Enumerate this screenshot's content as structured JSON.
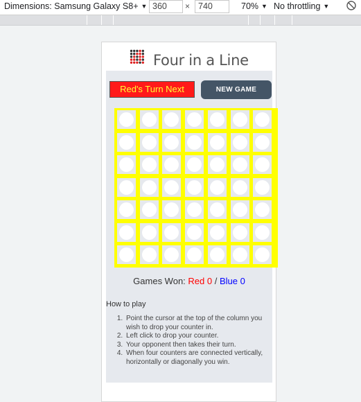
{
  "devtools": {
    "device_label": "Dimensions: Samsung Galaxy S8+",
    "width_value": "360",
    "height_value": "740",
    "times": "×",
    "zoom_label": "70%",
    "throttle_label": "No throttling",
    "dropdown_arrow": "▼",
    "rotate_icon": "⃠"
  },
  "app": {
    "title": "Four in a Line",
    "turn_label": "Red's Turn Next",
    "new_game_label": "NEW GAME",
    "board": {
      "columns": 7,
      "rows": 7
    },
    "score": {
      "prefix": "Games Won: ",
      "red_label": "Red 0",
      "separator": " / ",
      "blue_label": "Blue 0"
    },
    "howto": {
      "title": "How to play",
      "steps": [
        "Point the cursor at the top of the column you wish to drop your counter in.",
        "Left click to drop your counter.",
        "Your opponent then takes their turn.",
        "When four counters are connected vertically, horizontally or diagonally you win."
      ]
    }
  },
  "colors": {
    "board": "#ffff00",
    "turn_bg": "#ff1a1a",
    "turn_text": "#ffff33",
    "button_bg": "#445566",
    "panel_bg": "#e6e9ee"
  }
}
